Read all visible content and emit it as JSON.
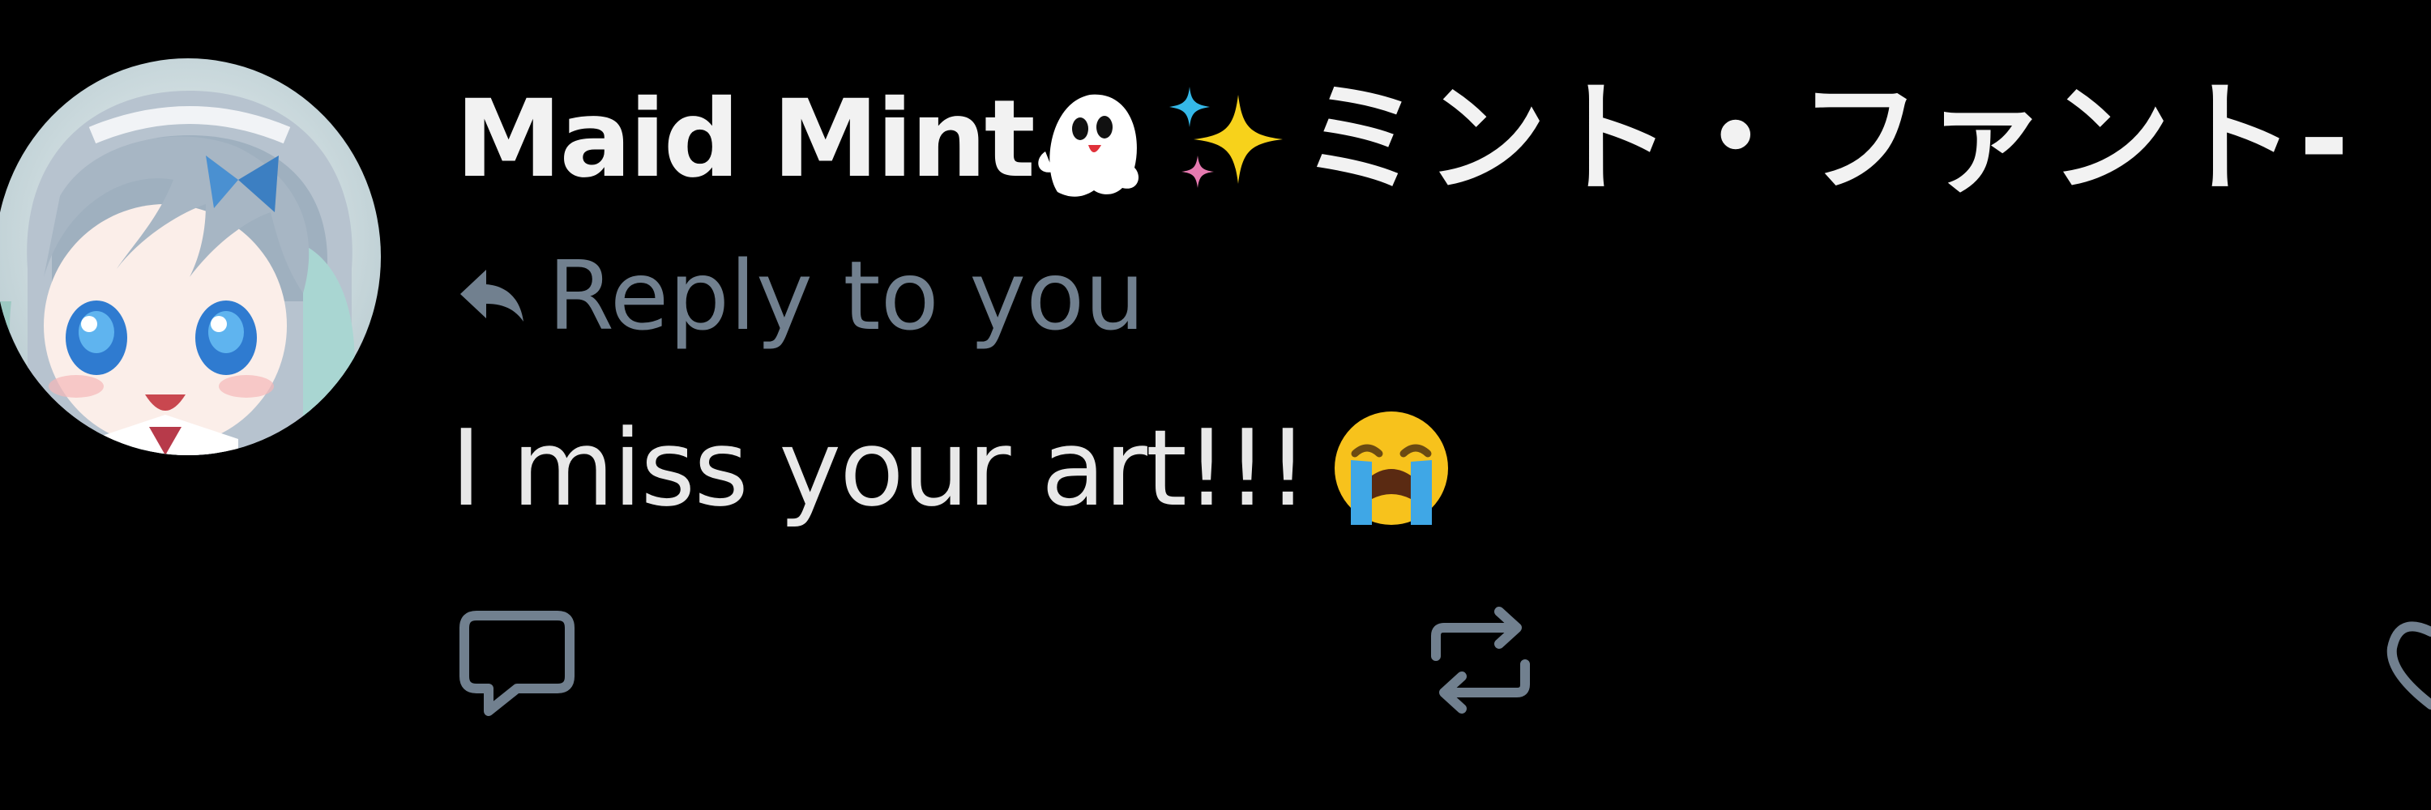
{
  "author": {
    "display_name": "Maid Mint",
    "name_suffix": "ミント・ファント-",
    "avatar": "anime-maid-avatar",
    "name_emojis": [
      "ghost-emoji",
      "sparkles-emoji"
    ]
  },
  "reply_context": {
    "icon": "reply-arrow-icon",
    "text": "Reply to you"
  },
  "tweet": {
    "text": "I miss your art!!!",
    "trailing_emoji": "loudly-crying-face-emoji"
  },
  "actions": [
    {
      "name": "reply",
      "icon": "comment-icon"
    },
    {
      "name": "retweet",
      "icon": "retweet-icon"
    },
    {
      "name": "like",
      "icon": "heart-icon"
    }
  ],
  "colors": {
    "background": "#000000",
    "text_primary": "#e8e8e8",
    "text_secondary": "#71808f",
    "icon": "#71808f"
  }
}
